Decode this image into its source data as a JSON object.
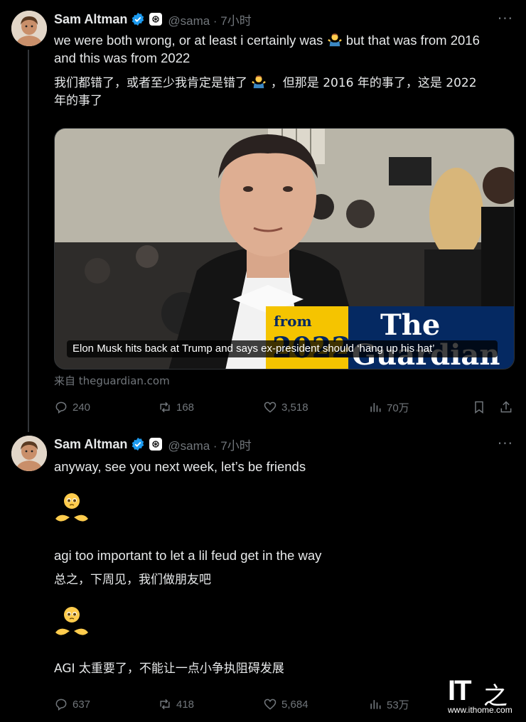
{
  "tweets": [
    {
      "author": "Sam Altman",
      "handle": "@sama · 7小时",
      "text_en": "we were both wrong, or at least i certainly was",
      "text_en_2": "but that was from 2016",
      "text_en_3": "and this was from 2022",
      "text_zh": "我们都错了，或者至少我肯定是错了",
      "text_zh_2": "，但那是 2016 年的事了，这是 2022",
      "text_zh_3": "年的事了",
      "card": {
        "headline": "Elon Musk hits back at Trump and says ex-president should ‘hang up his hat’",
        "banner_left": "from",
        "banner_left_2": "2022",
        "banner_right": "The",
        "banner_right_2": "Guardian",
        "source": "来自 theguardian.com"
      },
      "stats": {
        "replies": "240",
        "retweets": "168",
        "likes": "3,518",
        "views": "70万"
      }
    },
    {
      "author": "Sam Altman",
      "handle": "@sama · 7小时",
      "line1": "anyway, see you next week, let’s be friends",
      "line2": "agi too important to let a lil feud get in the way",
      "line3": "总之，下周见，我们做朋友吧",
      "line4": "AGI 太重要了，不能让一点小争执阻碍发展",
      "stats": {
        "replies": "637",
        "retweets": "418",
        "likes": "5,684",
        "views": "53万"
      }
    }
  ],
  "watermark": {
    "brand": "IT",
    "glyph": "之",
    "url": "www.ithome.com"
  },
  "icons": {
    "verified": "verified-badge-icon",
    "affiliation": "openai-logo-icon",
    "more": "more-icon",
    "reply": "reply-icon",
    "retweet": "retweet-icon",
    "like": "heart-icon",
    "views": "views-icon",
    "bookmark": "bookmark-icon",
    "share": "share-icon"
  },
  "colors": {
    "background": "#000000",
    "text": "#e7e9ea",
    "secondary": "#71767b",
    "verified": "#1d9bf0",
    "guardian_yellow": "#f5c400",
    "guardian_blue": "#052962"
  }
}
